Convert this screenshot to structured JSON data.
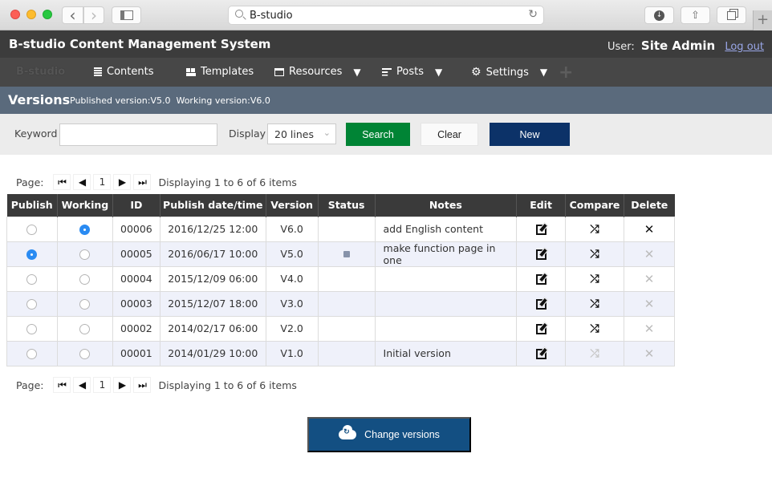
{
  "browser": {
    "url": "B-studio",
    "nav_back": "‹",
    "nav_forward": "›",
    "reload_icon": "↻",
    "new_tab": "+"
  },
  "app": {
    "title": "B-studio Content Management System",
    "user_label": "User:",
    "user_name": "Site Admin",
    "logout": "Log out"
  },
  "nav": {
    "brand": "B-studio",
    "items": [
      {
        "label": "Contents",
        "icon": "list-icon",
        "dropdown": false
      },
      {
        "label": "Templates",
        "icon": "template-icon",
        "dropdown": false
      },
      {
        "label": "Resources",
        "icon": "window-icon",
        "dropdown": true
      },
      {
        "label": "Posts",
        "icon": "posts-icon",
        "dropdown": true
      },
      {
        "label": "Settings",
        "icon": "gear-icon",
        "dropdown": true
      }
    ],
    "caret": "▼",
    "gear_glyph": "⚙",
    "add_glyph": "+"
  },
  "versions_bar": {
    "title": "Versions",
    "info": "Published version:V5.0  Working version:V6.0"
  },
  "search": {
    "keyword_label": "Keyword",
    "keyword_value": "",
    "display_label": "Display",
    "display_value": "20 lines",
    "display_arrow": "⌄",
    "search_button": "Search",
    "clear_button": "Clear",
    "new_button": "New"
  },
  "pager": {
    "label": "Page:",
    "first": "⏮",
    "prev": "◀",
    "page": "1",
    "next": "▶",
    "last": "⏭",
    "info": "Displaying 1 to 6 of 6 items"
  },
  "table": {
    "columns": [
      "Publish",
      "Working",
      "ID",
      "Publish date/time",
      "Version",
      "Status",
      "Notes",
      "Edit",
      "Compare",
      "Delete"
    ],
    "rows": [
      {
        "publish": false,
        "working": true,
        "id": "00006",
        "date": "2016/12/25 12:00",
        "version": "V6.0",
        "status": "",
        "notes": "add English content",
        "compare_enabled": true,
        "delete_enabled": true
      },
      {
        "publish": true,
        "working": false,
        "id": "00005",
        "date": "2016/06/17 10:00",
        "version": "V5.0",
        "status": "published",
        "notes": "make function page in one",
        "compare_enabled": true,
        "delete_enabled": false
      },
      {
        "publish": false,
        "working": false,
        "id": "00004",
        "date": "2015/12/09 06:00",
        "version": "V4.0",
        "status": "",
        "notes": "",
        "compare_enabled": true,
        "delete_enabled": false
      },
      {
        "publish": false,
        "working": false,
        "id": "00003",
        "date": "2015/12/07 18:00",
        "version": "V3.0",
        "status": "",
        "notes": "",
        "compare_enabled": true,
        "delete_enabled": false
      },
      {
        "publish": false,
        "working": false,
        "id": "00002",
        "date": "2014/02/17 06:00",
        "version": "V2.0",
        "status": "",
        "notes": "",
        "compare_enabled": true,
        "delete_enabled": false
      },
      {
        "publish": false,
        "working": false,
        "id": "00001",
        "date": "2014/01/29 10:00",
        "version": "V1.0",
        "status": "",
        "notes": "Initial version",
        "compare_enabled": false,
        "delete_enabled": false
      }
    ],
    "compare_glyph": "⤮",
    "delete_glyph": "✕"
  },
  "change_button": "Change versions",
  "colors": {
    "header_bg": "#3c3c3c",
    "nav_bg": "#474747",
    "versions_bar_bg": "#5a6a7c",
    "search_btn": "#008435",
    "new_btn": "#0c3268",
    "change_btn": "#134f82",
    "radio_on": "#2a8bf2",
    "alt_row": "#eff1fa"
  }
}
